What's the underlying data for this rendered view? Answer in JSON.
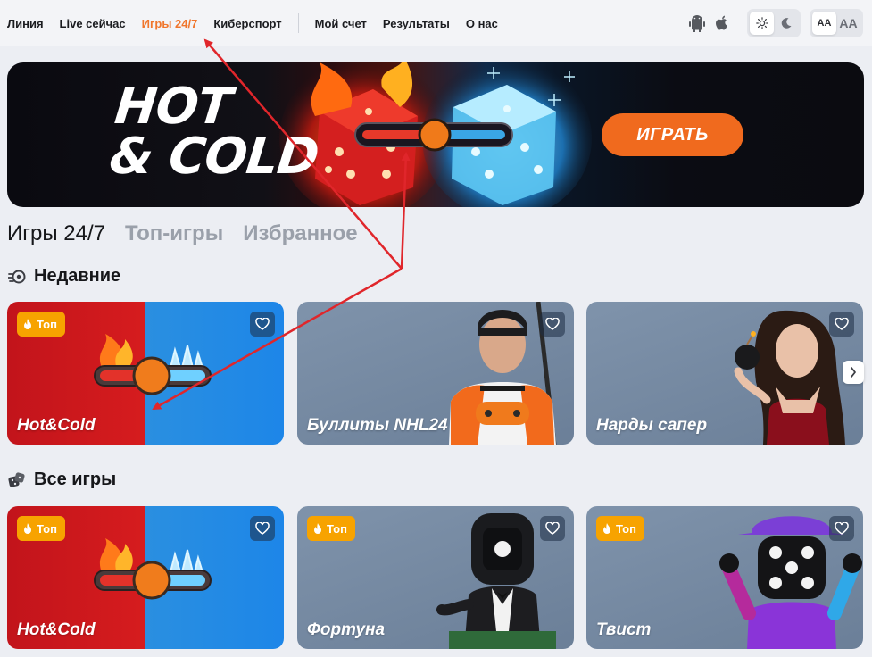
{
  "nav": {
    "items": [
      {
        "label": "Линия",
        "active": false
      },
      {
        "label": "Live сейчас",
        "active": false
      },
      {
        "label": "Игры 24/7",
        "active": true
      },
      {
        "label": "Киберспорт",
        "active": false
      }
    ],
    "items_right": [
      {
        "label": "Мой счет"
      },
      {
        "label": "Результаты"
      },
      {
        "label": "О нас"
      }
    ],
    "platform_icons": [
      "android-icon",
      "apple-icon"
    ],
    "theme_toggle": {
      "options": [
        "sun-icon",
        "moon-icon"
      ],
      "selected": "light"
    },
    "font_toggle": {
      "small": "AA",
      "large": "AA",
      "selected": "small"
    },
    "accent_color": "#f0762c"
  },
  "banner": {
    "title_line1": "HOT",
    "title_line2": "& COLD",
    "button_label": "ИГРАТЬ",
    "button_color": "#f06a1e"
  },
  "tabs": [
    {
      "label": "Игры 24/7",
      "active": true
    },
    {
      "label": "Топ-игры",
      "active": false
    },
    {
      "label": "Избранное",
      "active": false
    }
  ],
  "sections": {
    "recent": {
      "title": "Недавние",
      "icon": "recent-icon",
      "cards": [
        {
          "name": "Hot&Cold",
          "badge": "Топ"
        },
        {
          "name": "Буллиты NHL24",
          "badge": ""
        },
        {
          "name": "Нарды сапер",
          "badge": ""
        }
      ]
    },
    "all": {
      "title": "Все игры",
      "icon": "dice-icon",
      "cards": [
        {
          "name": "Hot&Cold",
          "badge": "Топ"
        },
        {
          "name": "Фортуна",
          "badge": "Топ"
        },
        {
          "name": "Твист",
          "badge": "Топ"
        }
      ]
    }
  },
  "badge_color": "#f7a300",
  "annotation_color": "#e0262b"
}
